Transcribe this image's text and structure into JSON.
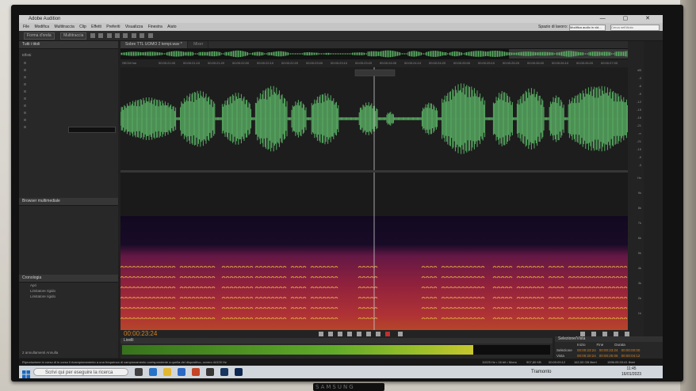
{
  "app": {
    "title": "Adobe Audition",
    "menu": [
      "File",
      "Modifica",
      "Multitraccia",
      "Clip",
      "Effetti",
      "Preferiti",
      "Visualizza",
      "Finestra",
      "Aiuto"
    ],
    "workspace_label": "Spazio di lavoro:",
    "workspace_value": "Modifica audio in vid...",
    "help_search_placeholder": "Cerca nell'Aiuto"
  },
  "toolbar": {
    "waveform_label": "Forma d'onda",
    "multitrack_label": "Multitraccia"
  },
  "left_panel": {
    "files_title": "Tutti i titoli",
    "effects_title": "Effetti",
    "browser_title": "Browser multimediale",
    "history_title": "Cronologia",
    "history_items": [
      "Apri",
      "Limitatore rigido",
      "Limitatore rigido"
    ],
    "status": "2 annullamenti Annulla"
  },
  "editor": {
    "tab": "Sobre TTL UOMO 2 tempi.wav *",
    "mixer_tab": "Mixer",
    "current_time": "00:00:23:24",
    "colors": {
      "waveform": "#5fb86a",
      "playhead": "#d9d9d9",
      "timecode": "#e08a2a"
    }
  },
  "ruler": {
    "first_label": "SECM hm",
    "ticks": [
      "00:00:21:00",
      "00:00:21:10",
      "00:00:21:20",
      "00:00:22:00",
      "00:00:22:10",
      "00:00:22:20",
      "00:00:23:00",
      "00:00:23:10",
      "00:00:23:20",
      "00:00:24:00",
      "00:00:24:10",
      "00:00:24:20",
      "00:00:25:00",
      "00:00:25:10",
      "00:00:25:20",
      "00:00:26:00",
      "00:00:26:10",
      "00:00:26:20",
      "00:00:27:00"
    ]
  },
  "levels": {
    "title": "Livelli",
    "fill_fraction": 0.82
  },
  "selection_view": {
    "title": "Selezione/Vista",
    "headers": [
      "Inizio",
      "Fine",
      "Durata"
    ],
    "selection_label": "Selezione",
    "view_label": "Vista",
    "selection": [
      "00:00:23:24",
      "00:00:23:24",
      "00:00:00:00"
    ],
    "view": [
      "00:00:20:24",
      "00:00:25:06",
      "00:00:04:12"
    ]
  },
  "statusbar": {
    "message": "Riproduzione in corso di in corso il ricampionamento a una frequenza di campionamento corrispondente a quella del dispositivo, ovvero 44100 Hz",
    "info": [
      "11025 Hz • 16 bit • Mono",
      "907,80 KB",
      "00:00:09:12",
      "162,53 GB liberi",
      "1596:05:03:41 liberi"
    ]
  },
  "taskbar": {
    "search_placeholder": "Scrivi qui per eseguire la ricerca",
    "weather": "Tramonto",
    "time": "11:45",
    "date": "16/01/2023"
  },
  "monitor": {
    "brand": "SAMSUNG"
  }
}
